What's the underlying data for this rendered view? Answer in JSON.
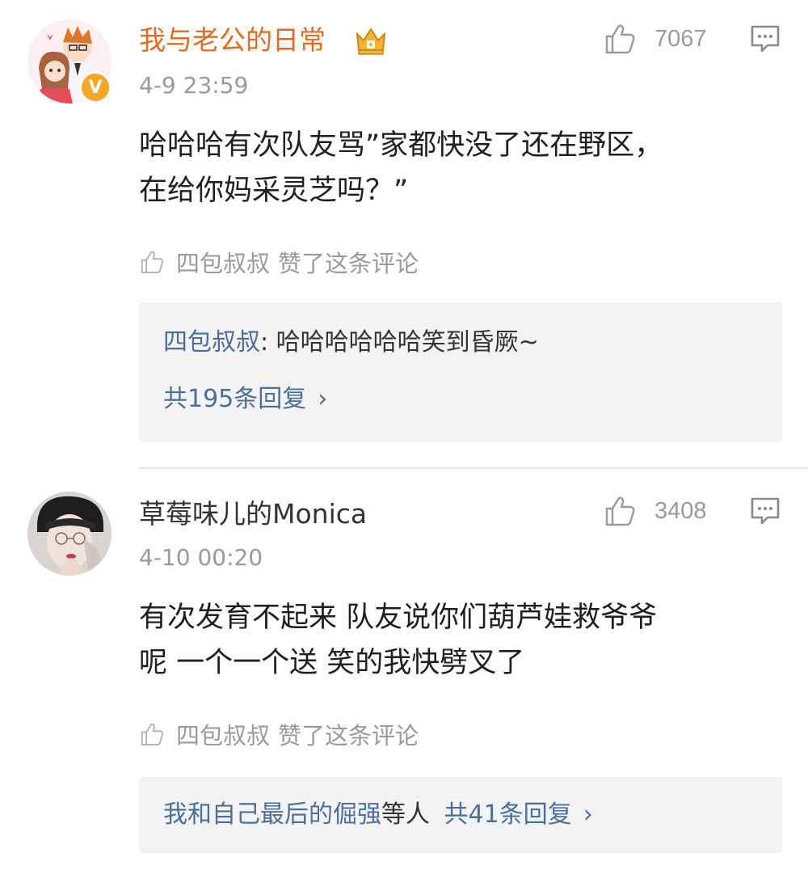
{
  "comments": [
    {
      "username": "我与老公的日常",
      "timestamp": "4-9 23:59",
      "likes": "7067",
      "verified_badge": "V",
      "body_lines": [
        "哈哈哈有次队友骂”家都快没了还在野区，",
        "在给你妈采灵芝吗？”"
      ],
      "liked_by": {
        "name": "四包叔叔",
        "text": "赞了这条评论"
      },
      "reply": {
        "author": "四包叔叔",
        "separator": ":",
        "text": "哈哈哈哈哈哈笑到昏厥~",
        "count_label": "共195条回复"
      }
    },
    {
      "username": "草莓味儿的Monica",
      "timestamp": "4-10 00:20",
      "likes": "3408",
      "body_lines": [
        "有次发育不起来 队友说你们葫芦娃救爷爷",
        "呢 一个一个送 笑的我快劈叉了"
      ],
      "liked_by": {
        "name": "四包叔叔",
        "text": "赞了这条评论"
      },
      "reply": {
        "author": "我和自己最后的倔强",
        "suffix": "等人",
        "count_label": "共41条回复"
      }
    }
  ],
  "icons": {
    "chevron": "›"
  },
  "colors": {
    "vip_name": "#e8681d",
    "link_blue": "#4a6f9c",
    "muted_gray": "#9a9a9a",
    "reply_bg": "#f3f3f3",
    "badge_orange": "#f5a623"
  }
}
